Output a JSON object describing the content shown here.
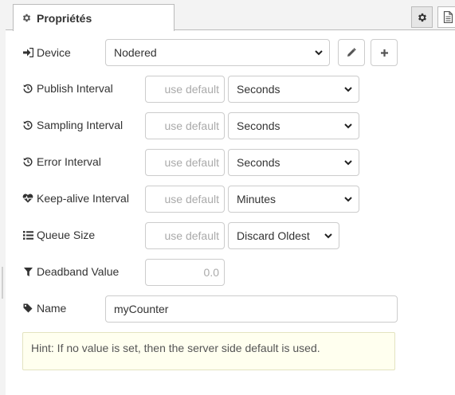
{
  "tab": {
    "title": "Propriétés",
    "gear_icon": "gear-icon",
    "doc_icon": "document-icon"
  },
  "form": {
    "device": {
      "label": "Device",
      "icon": "sign-in-icon",
      "selected": "Nodered",
      "edit_icon": "pencil-icon",
      "add_icon": "plus-icon"
    },
    "publish_interval": {
      "label": "Publish Interval",
      "icon": "history-icon",
      "placeholder": "use default",
      "value": "",
      "unit": "Seconds"
    },
    "sampling_interval": {
      "label": "Sampling Interval",
      "icon": "history-icon",
      "placeholder": "use default",
      "value": "",
      "unit": "Seconds"
    },
    "error_interval": {
      "label": "Error Interval",
      "icon": "history-icon",
      "placeholder": "use default",
      "value": "",
      "unit": "Seconds"
    },
    "keepalive_interval": {
      "label": "Keep-alive Interval",
      "icon": "heartbeat-icon",
      "placeholder": "use default",
      "value": "",
      "unit": "Minutes"
    },
    "queue_size": {
      "label": "Queue Size",
      "icon": "list-icon",
      "placeholder": "use default",
      "value": "",
      "policy": "Discard Oldest"
    },
    "deadband": {
      "label": "Deadband Value",
      "icon": "filter-icon",
      "placeholder": "0.0",
      "value": ""
    },
    "name": {
      "label": "Name",
      "icon": "tag-icon",
      "value": "myCounter"
    }
  },
  "hint": {
    "text": "Hint: If no value is set, then the server side default is used."
  }
}
